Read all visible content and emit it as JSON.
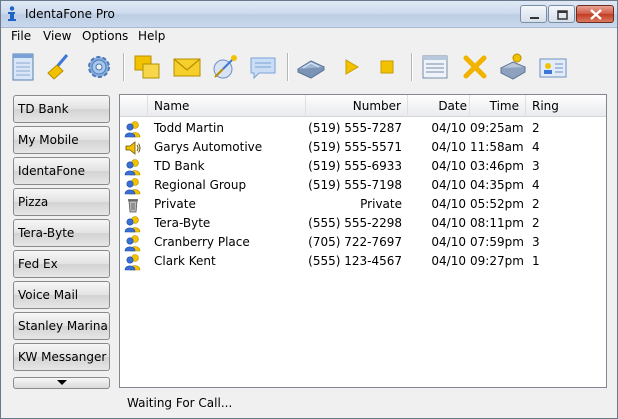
{
  "window": {
    "title": "IdentaFone Pro"
  },
  "menu": {
    "items": [
      "File",
      "View",
      "Options",
      "Help"
    ]
  },
  "toolbar": {
    "buttons": [
      "notepad-icon",
      "broom-icon",
      "gear-icon",
      "windows-icon",
      "envelope-icon",
      "satellite-icon",
      "speech-bubble-icon",
      "phonebook-icon",
      "play-icon",
      "stop-icon",
      "list-icon",
      "delete-icon",
      "fax-icon",
      "contact-card-icon"
    ]
  },
  "speed_dial": {
    "buttons": [
      "TD Bank",
      "My Mobile",
      "IdentaFone",
      "Pizza",
      "Tera-Byte",
      "Fed Ex",
      "Voice Mail",
      "Stanley Marina",
      "KW Messanger"
    ]
  },
  "call_list": {
    "columns": [
      "Name",
      "Number",
      "Date",
      "Time",
      "Ring"
    ],
    "rows": [
      {
        "icon": "person-icon",
        "name": "Todd Martin",
        "number": "(519) 555-7287",
        "date": "04/10",
        "time": "09:25am",
        "ring": "2"
      },
      {
        "icon": "speaker-icon",
        "name": "Garys Automotive",
        "number": "(519) 555-5571",
        "date": "04/10",
        "time": "11:58am",
        "ring": "4"
      },
      {
        "icon": "person-icon",
        "name": "TD Bank",
        "number": "(519) 555-6933",
        "date": "04/10",
        "time": "03:46pm",
        "ring": "3"
      },
      {
        "icon": "person-icon",
        "name": "Regional Group",
        "number": "(519) 555-7198",
        "date": "04/10",
        "time": "04:35pm",
        "ring": "4"
      },
      {
        "icon": "trash-icon",
        "name": "Private",
        "number": "Private",
        "date": "04/10",
        "time": "05:52pm",
        "ring": "2"
      },
      {
        "icon": "person-icon",
        "name": "Tera-Byte",
        "number": "(555) 555-2298",
        "date": "04/10",
        "time": "08:11pm",
        "ring": "2"
      },
      {
        "icon": "person-icon",
        "name": "Cranberry Place",
        "number": "(705) 722-7697",
        "date": "04/10",
        "time": "07:59pm",
        "ring": "3"
      },
      {
        "icon": "person-icon",
        "name": "Clark Kent",
        "number": "(555) 123-4567",
        "date": "04/10",
        "time": "09:27pm",
        "ring": "1"
      }
    ]
  },
  "status": {
    "text": "Waiting For Call..."
  },
  "colors": {
    "title_bar": "#cfdcee",
    "accent_blue": "#3a6fd8",
    "toolbar_yellow": "#f2c200",
    "close_red": "#c23b22"
  }
}
